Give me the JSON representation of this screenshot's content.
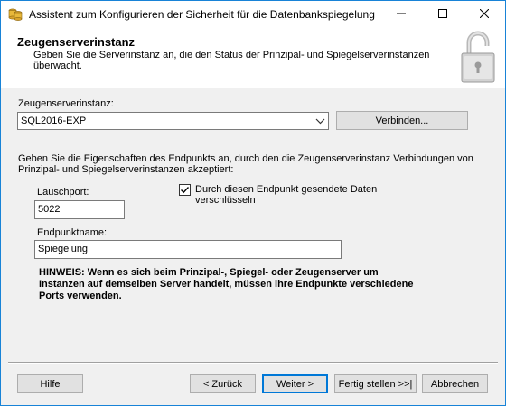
{
  "window": {
    "title": "Assistent zum Konfigurieren der Sicherheit für die Datenbankspiegelung"
  },
  "banner": {
    "title": "Zeugenserverinstanz",
    "subtitle": "Geben Sie die Serverinstanz an, die den Status der Prinzipal- und Spiegelserverinstanzen überwacht."
  },
  "witness": {
    "label": "Zeugenserverinstanz:",
    "selected_value": "SQL2016-EXP",
    "connect_label": "Verbinden..."
  },
  "endpoint": {
    "description": "Geben Sie die Eigenschaften des Endpunkts an, durch den die Zeugenserverinstanz Verbindungen von Prinzipal- und Spiegelserverinstanzen akzeptiert:",
    "port_label": "Lauschport:",
    "port_value": "5022",
    "encrypt_label": "Durch diesen Endpunkt gesendete Daten verschlüsseln",
    "encrypt_checked": true,
    "name_label": "Endpunktname:",
    "name_value": "Spiegelung"
  },
  "hint": "HINWEIS: Wenn es sich beim Prinzipal-, Spiegel- oder Zeugenserver um Instanzen auf demselben Server handelt, müssen ihre Endpunkte verschiedene Ports verwenden.",
  "footer": {
    "help_label": "Hilfe",
    "back_label": "< Zurück",
    "next_label": "Weiter >",
    "finish_label": "Fertig stellen >>|",
    "cancel_label": "Abbrechen"
  },
  "colors": {
    "accent": "#0078d7",
    "window_border": "#1883d7",
    "dialog_bg": "#f0f0f0",
    "button_bg": "#e1e1e1"
  },
  "icons": [
    "database-mirroring-app-icon",
    "minimize-icon",
    "maximize-icon",
    "close-icon",
    "padlock-icon",
    "chevron-down-icon",
    "checkmark-icon"
  ]
}
